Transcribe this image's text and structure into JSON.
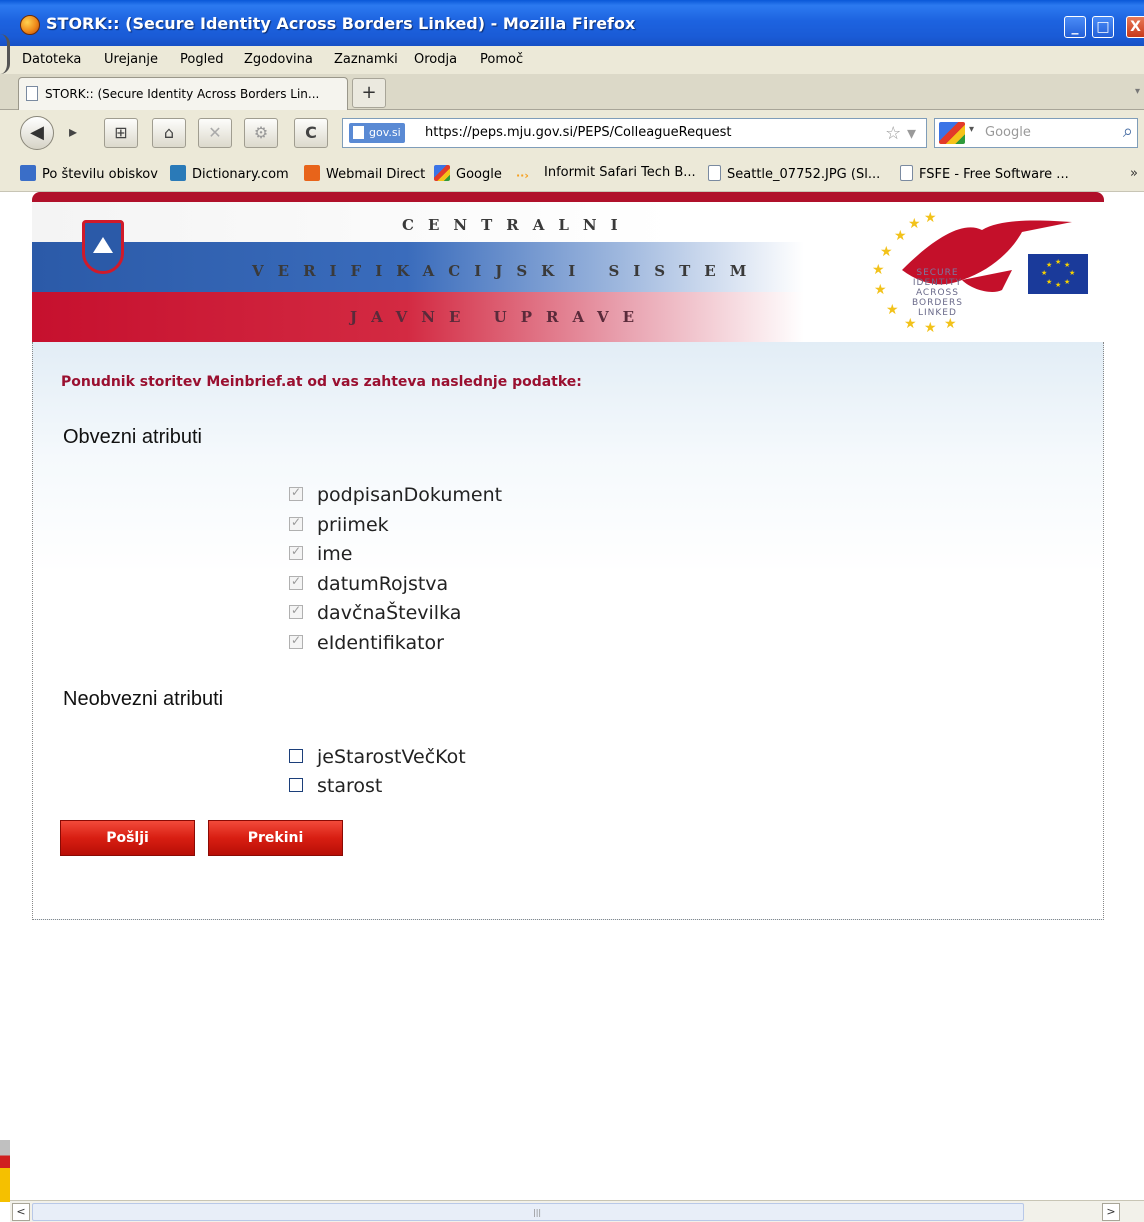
{
  "window": {
    "title": "STORK:: (Secure Identity Across Borders Linked) - Mozilla Firefox",
    "minimize": "_",
    "maximize": "□",
    "close": "X"
  },
  "menu": [
    "Datoteka",
    "Urejanje",
    "Pogled",
    "Zgodovina",
    "Zaznamki",
    "Orodja",
    "Pomoč"
  ],
  "tab": {
    "label": "STORK:: (Secure Identity Across Borders Lin...",
    "new_tab": "+",
    "scroll_indicator": "▾"
  },
  "navigation": {
    "back": "◀",
    "forward": "▸",
    "page_action": "⊞",
    "home": "⌂",
    "stop": "✕",
    "addon": "⚙",
    "reload": "C",
    "site_label": "gov.si",
    "url": "https://peps.mju.gov.si/PEPS/ColleagueRequest",
    "bookmark_star": "☆ ▾",
    "search_engine_dropdown": "▾",
    "search_placeholder": "Google",
    "search_button": "⌕"
  },
  "bookmarks": [
    {
      "label": "Po številu obiskov",
      "icon": "most-visited-icon",
      "color": "#3a6ec8"
    },
    {
      "label": "Dictionary.com",
      "icon": "dictionary-icon",
      "color": "#2a7ab8"
    },
    {
      "label": "Webmail Direct",
      "icon": "webmail-icon",
      "color": "#e8641a"
    },
    {
      "label": "Google",
      "icon": "google-icon",
      "color": "#e23a2a"
    },
    {
      "label": "Informit Safari Tech B...",
      "icon": "informit-icon",
      "color": "#f5a020"
    },
    {
      "label": "Seattle_07752.JPG (Sl...",
      "icon": "page-icon",
      "color": "#dfe6f0"
    },
    {
      "label": "FSFE - Free Software ...",
      "icon": "page-icon",
      "color": "#dfe6f0"
    }
  ],
  "bookmarks_overflow": "»",
  "banner": {
    "line1": "CENTRALNI",
    "line2": "VERIFIKACIJSKI SISTEM",
    "line3": "JAVNE UPRAVE",
    "stork_text": [
      "SECURE",
      "IDENTITY",
      "ACROSS",
      "BORDERS",
      "LINKED"
    ]
  },
  "form": {
    "request_text": "Ponudnik storitev Meinbrief.at od vas zahteva naslednje podatke:",
    "mandatory_title": "Obvezni atributi",
    "mandatory_attributes": [
      {
        "label": "podpisanDokument",
        "checked": true
      },
      {
        "label": "priimek",
        "checked": true
      },
      {
        "label": "ime",
        "checked": true
      },
      {
        "label": "datumRojstva",
        "checked": true
      },
      {
        "label": "davčnaŠtevilka",
        "checked": true
      },
      {
        "label": "eIdentifikator",
        "checked": true
      }
    ],
    "optional_title": "Neobvezni atributi",
    "optional_attributes": [
      {
        "label": "jeStarostVečKot",
        "checked": false
      },
      {
        "label": "starost",
        "checked": false
      }
    ],
    "submit_label": "Pošlji",
    "cancel_label": "Prekini"
  },
  "scrollbar": {
    "left": "<",
    "right": ">",
    "grip": "|||"
  },
  "colors": {
    "titlebar": "#1d63e0",
    "chrome": "#ece9d8",
    "request_text": "#9a1030",
    "button_red": "#d81e12",
    "flag_blue": "#2b5aa8",
    "flag_red": "#c6102e"
  }
}
